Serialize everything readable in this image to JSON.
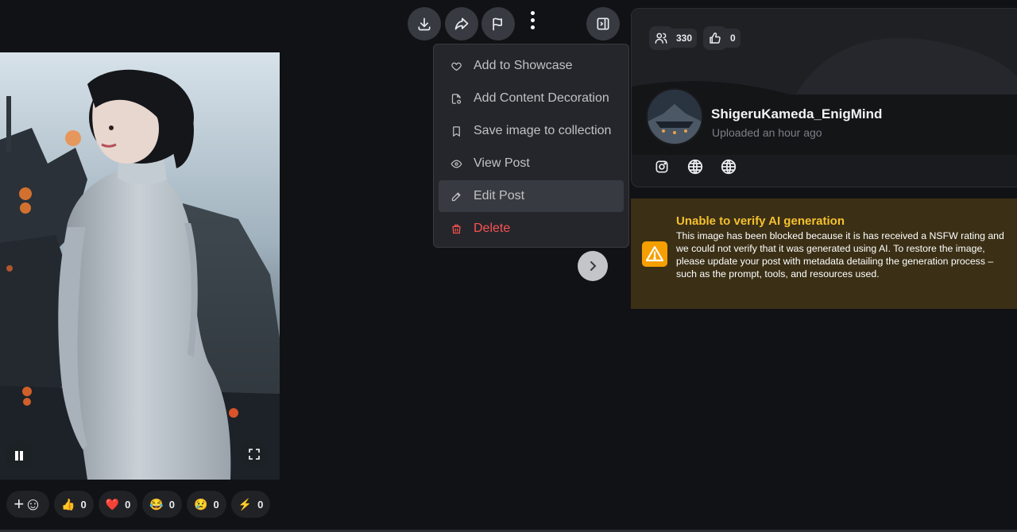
{
  "toolbar": {
    "download_icon": "download-icon",
    "share_icon": "share-icon",
    "report_icon": "flag-icon",
    "more_icon": "dots-vertical-icon",
    "panel_icon": "layout-sidebar-right-icon"
  },
  "menu": {
    "items": [
      {
        "label": "Add to Showcase",
        "icon": "heart-icon"
      },
      {
        "label": "Add Content Decoration",
        "icon": "file-decoration-icon"
      },
      {
        "label": "Save image to collection",
        "icon": "bookmark-icon"
      },
      {
        "label": "View Post",
        "icon": "eye-icon"
      },
      {
        "label": "Edit Post",
        "icon": "pencil-icon"
      },
      {
        "label": "Delete",
        "icon": "trash-icon",
        "color": "#fa5252"
      }
    ]
  },
  "profile": {
    "followers": "330",
    "likes": "0",
    "username": "ShigeruKameda_EnigMind",
    "uploaded": "Uploaded an hour ago",
    "links": [
      "instagram-icon",
      "globe-icon",
      "globe-icon"
    ]
  },
  "warning": {
    "title": "Unable to verify AI generation",
    "body": "This image has been blocked because it is has received a NSFW rating and we could not verify that it was generated using AI. To restore the image, please update your post with metadata detailing the generation process – such as the prompt, tools, and resources used.",
    "accent": "#f59f00"
  },
  "reactions": {
    "add_label": "+☺",
    "items": [
      {
        "emoji": "👍",
        "count": "0"
      },
      {
        "emoji": "❤️",
        "count": "0"
      },
      {
        "emoji": "😂",
        "count": "0"
      },
      {
        "emoji": "😢",
        "count": "0"
      },
      {
        "emoji": "⚡",
        "count": "0"
      }
    ]
  }
}
